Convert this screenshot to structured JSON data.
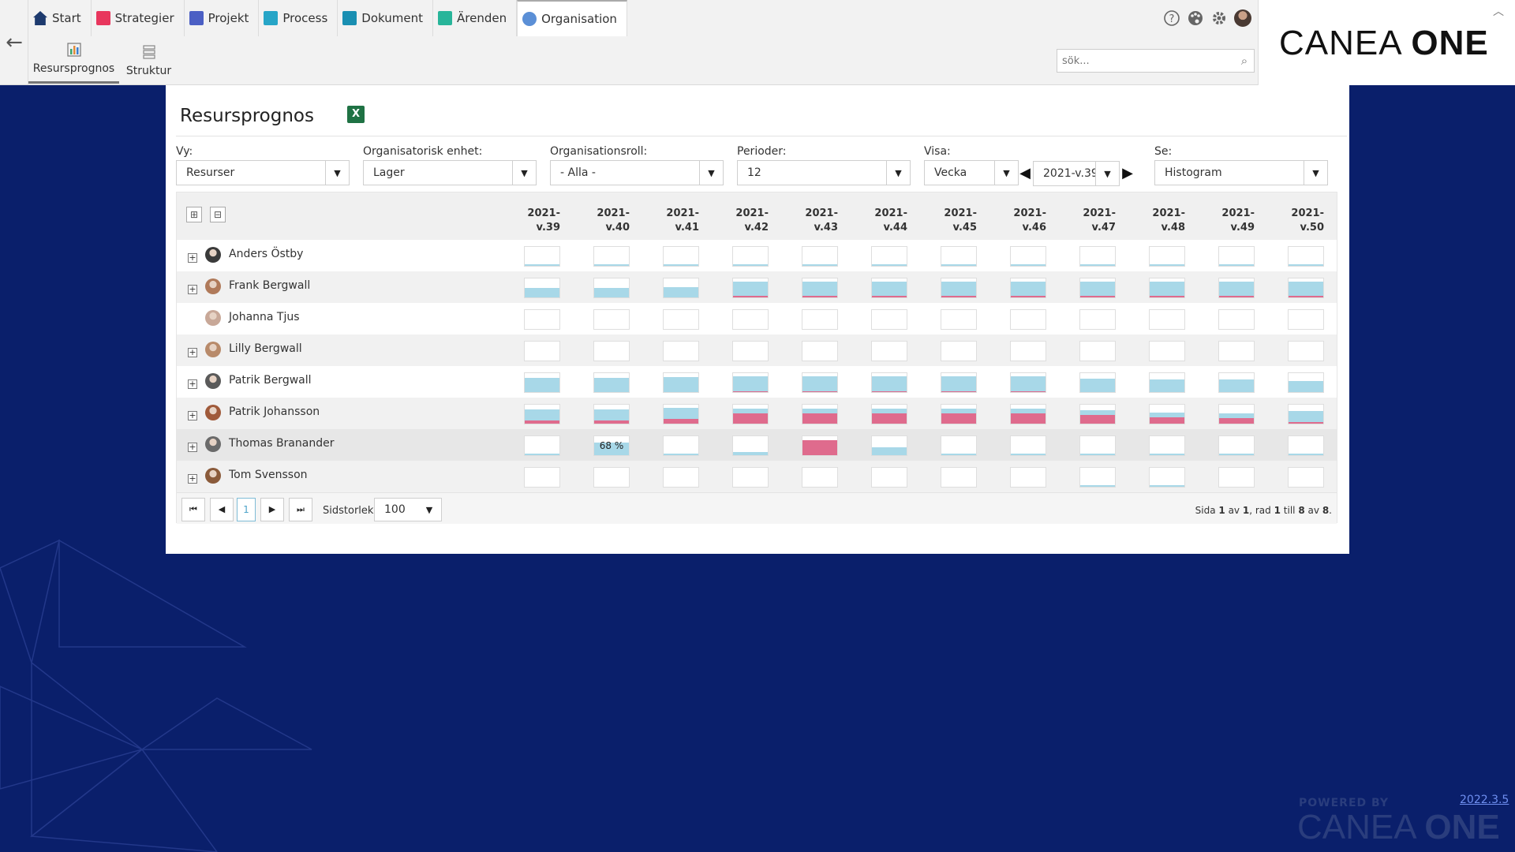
{
  "nav": {
    "tabs": [
      {
        "label": "Start",
        "icon": "home-icon",
        "color": "#1d3a6e"
      },
      {
        "label": "Strategier",
        "icon": "strategy-icon",
        "color": "#e8365d"
      },
      {
        "label": "Projekt",
        "icon": "project-icon",
        "color": "#4b5fc4"
      },
      {
        "label": "Process",
        "icon": "process-icon",
        "color": "#27a5c7"
      },
      {
        "label": "Dokument",
        "icon": "document-icon",
        "color": "#1a8fb2"
      },
      {
        "label": "Ärenden",
        "icon": "case-icon",
        "color": "#28b59a"
      },
      {
        "label": "Organisation",
        "icon": "organisation-icon",
        "color": "#5b8fd6"
      }
    ],
    "active_tab": "Organisation",
    "sub_tabs": [
      {
        "label": "Resursprognos",
        "icon": "chart-icon"
      },
      {
        "label": "Struktur",
        "icon": "structure-icon"
      }
    ],
    "active_sub_tab": "Resursprognos"
  },
  "header": {
    "search_placeholder": "sök...",
    "icons": [
      "help-icon",
      "palette-icon",
      "settings-icon",
      "user-avatar"
    ]
  },
  "panel": {
    "title": "Resursprognos",
    "filters": {
      "vy": {
        "label": "Vy:",
        "value": "Resurser"
      },
      "enhet": {
        "label": "Organisatorisk enhet:",
        "value": "Lager"
      },
      "roll": {
        "label": "Organisationsroll:",
        "value": "- Alla -"
      },
      "perioder": {
        "label": "Perioder:",
        "value": "12"
      },
      "visa": {
        "label": "Visa:",
        "value": "Vecka",
        "period": "2021-v.39"
      },
      "se": {
        "label": "Se:",
        "value": "Histogram"
      }
    }
  },
  "grid": {
    "columns": [
      "2021-\nv.39",
      "2021-\nv.40",
      "2021-\nv.41",
      "2021-\nv.42",
      "2021-\nv.43",
      "2021-\nv.44",
      "2021-\nv.45",
      "2021-\nv.46",
      "2021-\nv.47",
      "2021-\nv.48",
      "2021-\nv.49",
      "2021-\nv.50"
    ],
    "rows": [
      {
        "name": "Anders Östby",
        "expandable": true,
        "blue": [
          0.08,
          0.08,
          0.08,
          0.08,
          0.08,
          0.08,
          0.08,
          0.08,
          0.08,
          0.08,
          0.08,
          0.08
        ],
        "red": [
          0,
          0,
          0,
          0,
          0,
          0,
          0,
          0,
          0,
          0,
          0,
          0
        ]
      },
      {
        "name": "Frank Bergwall",
        "expandable": true,
        "blue": [
          0.5,
          0.5,
          0.55,
          0.75,
          0.75,
          0.75,
          0.75,
          0.75,
          0.75,
          0.75,
          0.75,
          0.75
        ],
        "red": [
          0,
          0,
          0,
          0.08,
          0.08,
          0.08,
          0.08,
          0.08,
          0.08,
          0.08,
          0.08,
          0.08
        ]
      },
      {
        "name": "Johanna Tjus",
        "expandable": false,
        "blue": [
          0,
          0,
          0,
          0,
          0,
          0,
          0,
          0,
          0,
          0,
          0,
          0
        ],
        "red": [
          0,
          0,
          0,
          0,
          0,
          0,
          0,
          0,
          0,
          0,
          0,
          0
        ]
      },
      {
        "name": "Lilly Bergwall",
        "expandable": true,
        "blue": [
          0,
          0,
          0,
          0,
          0,
          0,
          0,
          0,
          0,
          0,
          0,
          0
        ],
        "red": [
          0,
          0,
          0,
          0,
          0,
          0,
          0,
          0,
          0,
          0,
          0,
          0
        ]
      },
      {
        "name": "Patrik Bergwall",
        "expandable": true,
        "blue": [
          0.75,
          0.75,
          0.8,
          0.8,
          0.8,
          0.8,
          0.8,
          0.8,
          0.7,
          0.65,
          0.65,
          0.6
        ],
        "red": [
          0,
          0,
          0,
          0.05,
          0.05,
          0.05,
          0.05,
          0.05,
          0,
          0,
          0,
          0
        ]
      },
      {
        "name": "Patrik Johansson",
        "expandable": true,
        "blue": [
          0.6,
          0.6,
          0.6,
          0.25,
          0.25,
          0.25,
          0.25,
          0.25,
          0.25,
          0.25,
          0.25,
          0.6
        ],
        "red": [
          0.15,
          0.15,
          0.25,
          0.55,
          0.55,
          0.55,
          0.55,
          0.55,
          0.45,
          0.35,
          0.3,
          0.1
        ]
      },
      {
        "name": "Thomas Branander",
        "expandable": true,
        "blue": [
          0.08,
          0.68,
          0.08,
          0.15,
          0,
          0.4,
          0.08,
          0.08,
          0.08,
          0.08,
          0.08,
          0.08
        ],
        "red": [
          0,
          0,
          0,
          0,
          0.8,
          0,
          0,
          0,
          0,
          0,
          0,
          0
        ],
        "label": {
          "col": 1,
          "text": "68 %"
        }
      },
      {
        "name": "Tom Svensson",
        "expandable": true,
        "blue": [
          0,
          0,
          0,
          0,
          0,
          0,
          0,
          0,
          0.05,
          0.05,
          0,
          0
        ],
        "red": [
          0,
          0,
          0,
          0,
          0,
          0,
          0,
          0,
          0,
          0,
          0,
          0
        ]
      }
    ],
    "pager": {
      "current_page": "1",
      "page_size_label": "Sidstorlek:",
      "page_size": "100",
      "info_prefix": "Sida",
      "page": "1",
      "of": "av",
      "pages": "1",
      "rad_label": ", rad",
      "from": "1",
      "till": "till",
      "to": "8",
      "av2": "av",
      "total": "8"
    }
  },
  "footer": {
    "powered_by": "POWERED BY",
    "logo_light": "CANEA",
    "logo_bold": "ONE",
    "version": "2022.3.5"
  },
  "brand": {
    "logo_light": "CANEA",
    "logo_bold": "ONE"
  },
  "colors": {
    "background": "#0a1f6b",
    "bar_blue": "#a8d8e8",
    "bar_red": "#df6b8d",
    "excel_green": "#1f7244"
  }
}
